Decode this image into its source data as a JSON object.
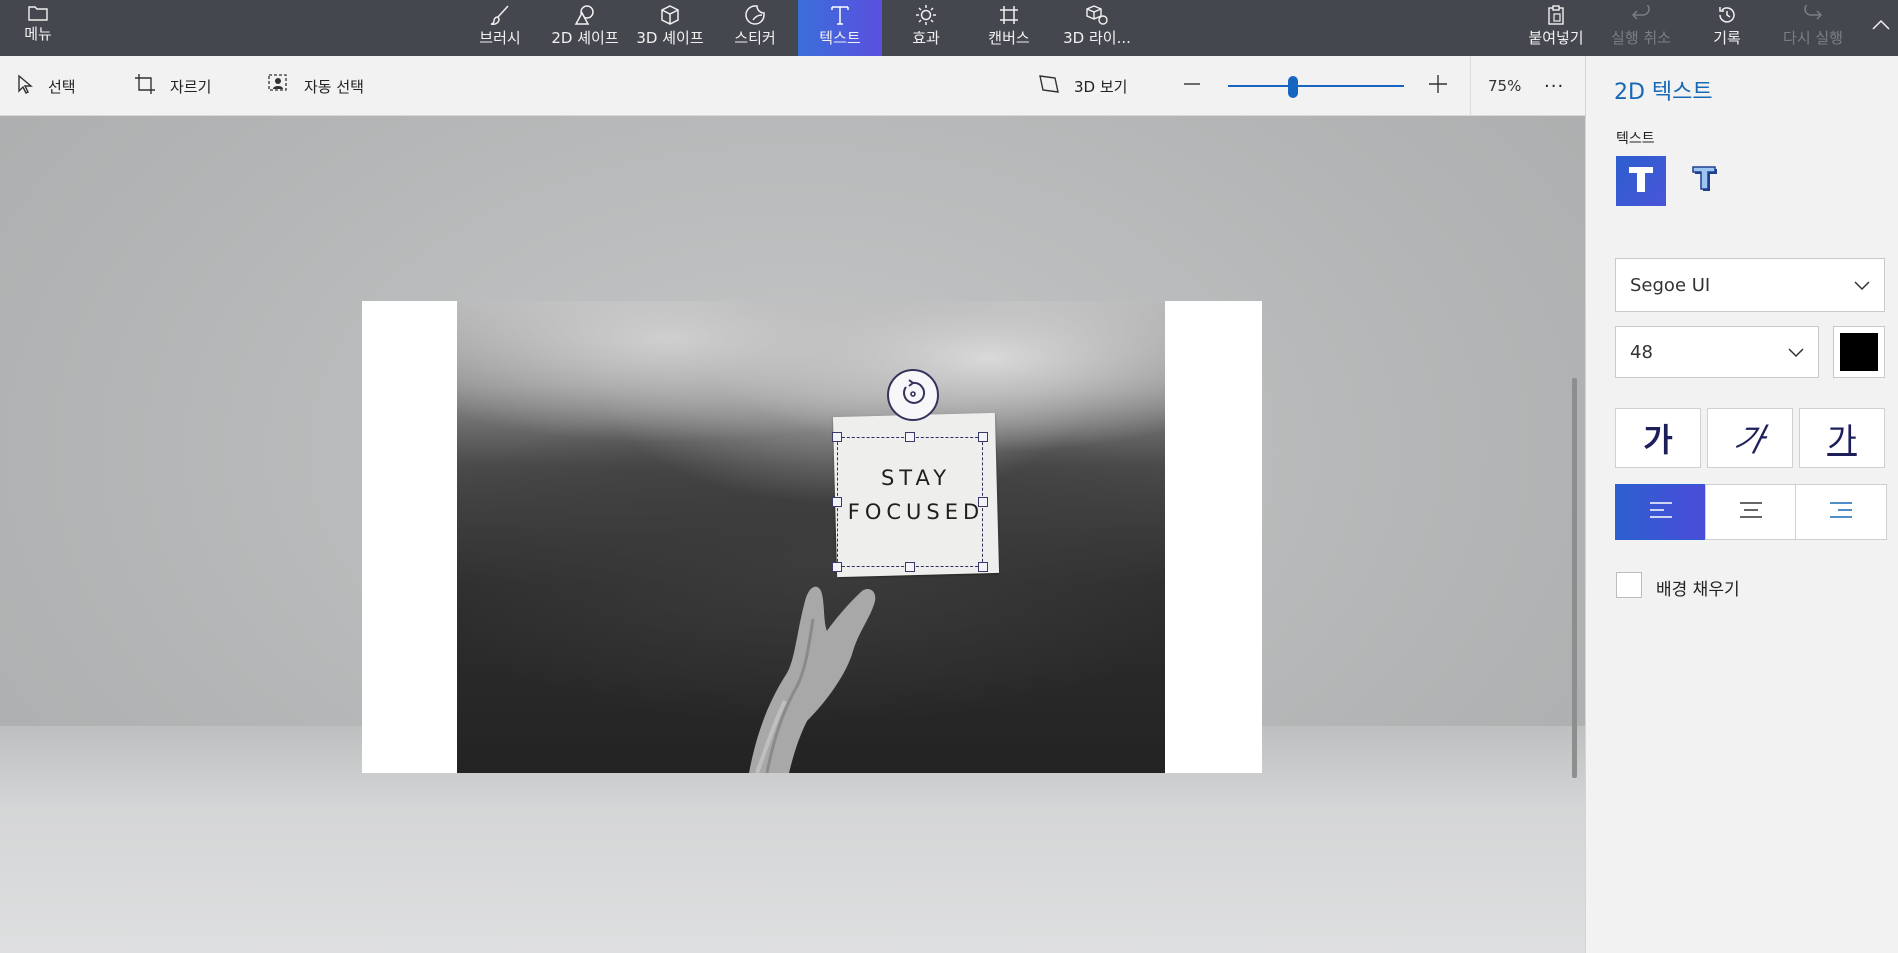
{
  "topbar": {
    "menu_label": "메뉴",
    "tools": [
      {
        "label": "브러시",
        "icon": "brush-icon"
      },
      {
        "label": "2D 셰이프",
        "icon": "shapes-2d-icon"
      },
      {
        "label": "3D 셰이프",
        "icon": "cube-icon"
      },
      {
        "label": "스티커",
        "icon": "sticker-icon"
      },
      {
        "label": "텍스트",
        "icon": "text-icon",
        "active": true
      },
      {
        "label": "효과",
        "icon": "effects-sun-icon"
      },
      {
        "label": "캔버스",
        "icon": "canvas-crop-icon"
      },
      {
        "label": "3D 라이...",
        "icon": "library-3d-icon"
      }
    ],
    "right": [
      {
        "label": "붙여넣기",
        "icon": "paste-icon",
        "enabled": true
      },
      {
        "label": "실행 취소",
        "icon": "undo-icon",
        "enabled": false
      },
      {
        "label": "기록",
        "icon": "history-icon",
        "enabled": true
      },
      {
        "label": "다시 실행",
        "icon": "redo-icon",
        "enabled": false
      }
    ],
    "accent_gradient": [
      "#3a6fd8",
      "#5b4fe0"
    ]
  },
  "subbar": {
    "select_label": "선택",
    "crop_label": "자르기",
    "magic_select_label": "자동 선택",
    "view3d_label": "3D 보기",
    "zoom_value": "75%",
    "zoom_fraction": 0.37,
    "more_label": "···"
  },
  "canvas": {
    "note_line1": "STAY",
    "note_line2": "FOCUSED"
  },
  "panel": {
    "title": "2D 텍스트",
    "text_section_label": "텍스트",
    "font_name": "Segoe UI",
    "font_size": "48",
    "text_color": "#000000",
    "bold_glyph": "가",
    "italic_glyph": "가",
    "underline_glyph": "가",
    "alignment": "left",
    "fill_background_label": "배경 채우기",
    "fill_background_checked": false
  }
}
